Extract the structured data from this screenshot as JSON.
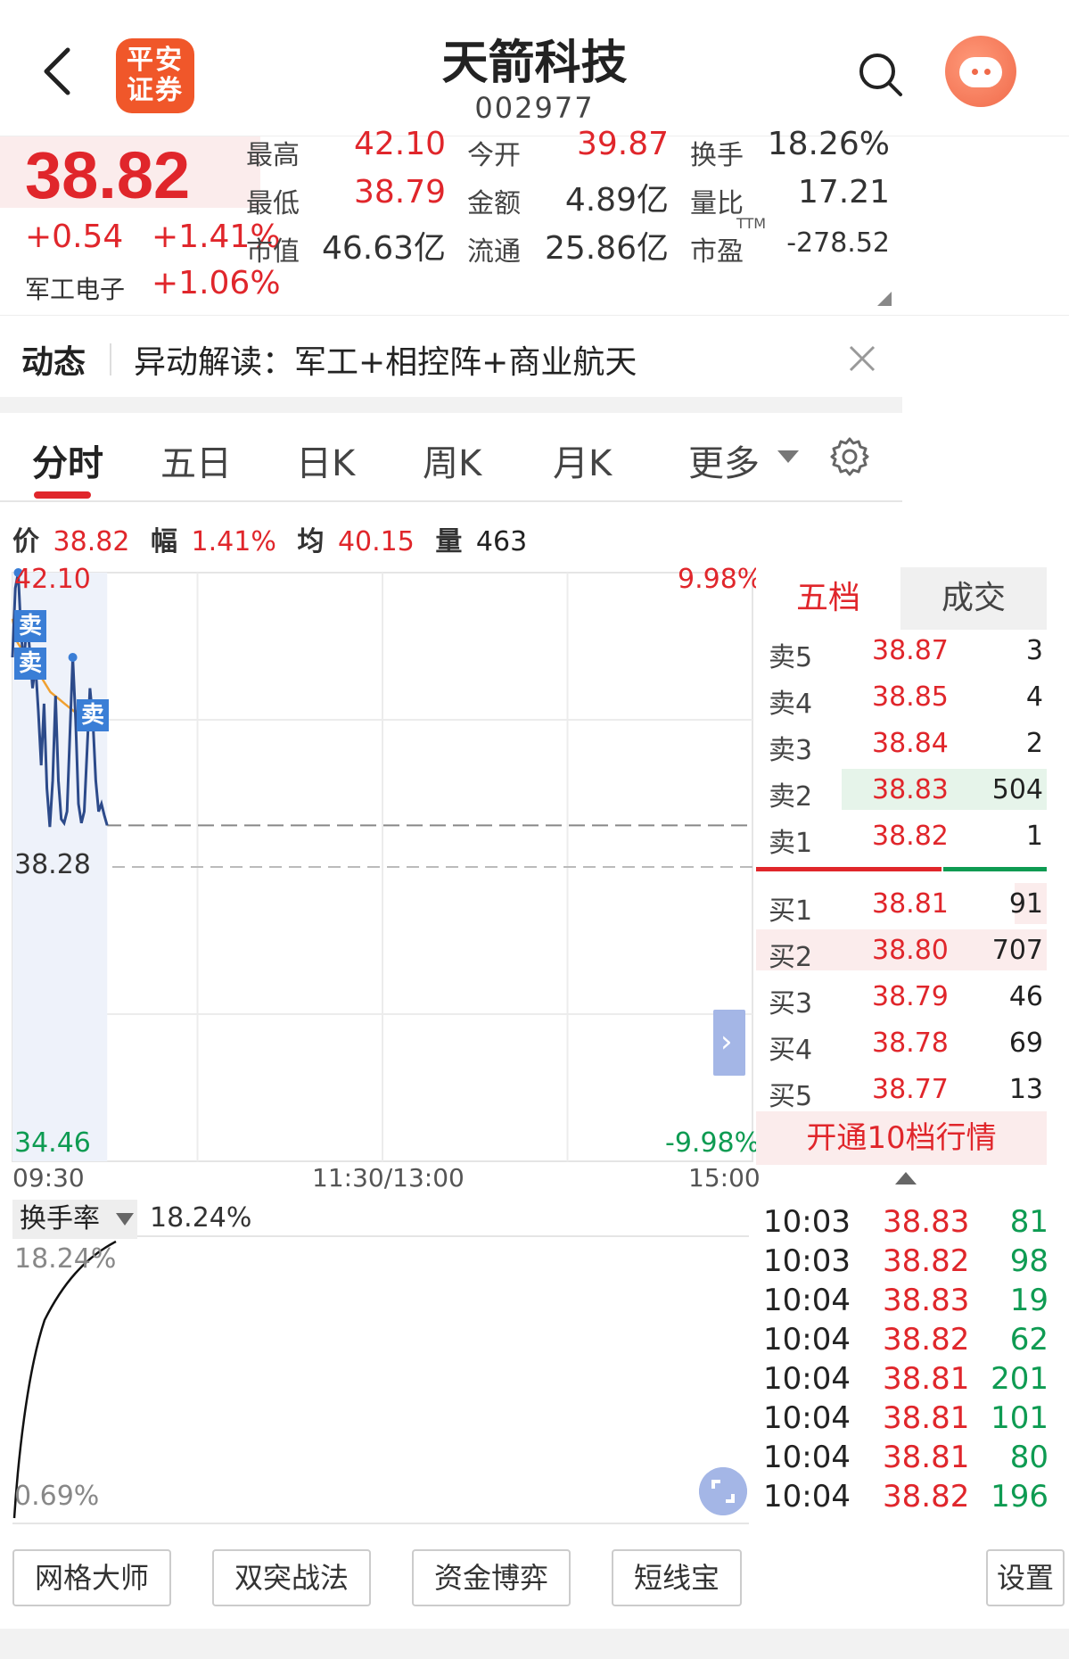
{
  "header": {
    "logo_line1": "平安",
    "logo_line2": "证券",
    "stock_name": "天箭科技",
    "stock_code": "002977"
  },
  "quote": {
    "price": "38.82",
    "change": "+0.54",
    "change_pct": "+1.41%",
    "sector_name": "军工电子",
    "sector_pct": "+1.06%",
    "fields": [
      {
        "label": "最高",
        "value": "42.10",
        "color": "red"
      },
      {
        "label": "今开",
        "value": "39.87",
        "color": "red"
      },
      {
        "label": "换手",
        "value": "18.26%",
        "color": "black"
      },
      {
        "label": "最低",
        "value": "38.79",
        "color": "red"
      },
      {
        "label": "金额",
        "value": "4.89亿",
        "color": "black"
      },
      {
        "label": "量比",
        "value": "17.21",
        "color": "black"
      },
      {
        "label": "市值",
        "value": "46.63亿",
        "color": "black"
      },
      {
        "label": "流通",
        "value": "25.86亿",
        "color": "black"
      },
      {
        "label": "市盈",
        "value": "-278.52",
        "color": "black"
      }
    ],
    "pe_superscript": "TTM"
  },
  "news": {
    "tag": "动态",
    "text": "异动解读：军工+相控阵+商业航天"
  },
  "tabs": [
    "分时",
    "五日",
    "日K",
    "周K",
    "月K",
    "更多"
  ],
  "info_row": {
    "price_label": "价",
    "price_value": "38.82",
    "range_label": "幅",
    "range_value": "1.41%",
    "avg_label": "均",
    "avg_value": "40.15",
    "vol_label": "量",
    "vol_value": "463"
  },
  "chart": {
    "y_max_label": "42.10",
    "y_mid_label": "38.28",
    "y_min_label": "34.46",
    "pct_max_label": "9.98%",
    "pct_min_label": "-9.98%",
    "sell_tag": "卖",
    "time_labels": [
      "09:30",
      "11:30/13:00",
      "15:00"
    ],
    "expand_glyph": "›"
  },
  "chart_data": {
    "type": "line",
    "title": "",
    "xlabel": "",
    "ylabel": "",
    "ylim": [
      34.46,
      42.1
    ],
    "prev_close": 38.28,
    "x_range": [
      "09:30",
      "15:00"
    ],
    "series": [
      {
        "values": [
          41.0,
          41.9,
          42.1,
          41.3,
          40.9,
          41.5,
          41.1,
          40.6,
          40.9,
          40.3,
          39.6,
          40.4,
          39.3,
          38.8,
          39.4,
          40.5,
          39.4,
          38.9,
          38.85,
          39.0,
          40.0,
          41.0,
          40.2,
          39.1,
          38.85,
          39.0,
          39.8,
          40.6,
          40.2,
          39.4,
          39.0,
          39.1,
          38.95,
          38.82
        ]
      },
      {
        "values": [
          41.5,
          41.2,
          41.1,
          41.0,
          40.95,
          40.85,
          40.75,
          40.65,
          40.55,
          40.5,
          40.45,
          40.4,
          40.35,
          40.3,
          40.3,
          40.28,
          40.25,
          40.22,
          40.2,
          40.18,
          40.15
        ]
      }
    ]
  },
  "order_book": {
    "tab_active": "五档",
    "tab_other": "成交",
    "asks": [
      {
        "label": "卖5",
        "price": "38.87",
        "qty": "3"
      },
      {
        "label": "卖4",
        "price": "38.85",
        "qty": "4"
      },
      {
        "label": "卖3",
        "price": "38.84",
        "qty": "2"
      },
      {
        "label": "卖2",
        "price": "38.83",
        "qty": "504"
      },
      {
        "label": "卖1",
        "price": "38.82",
        "qty": "1"
      }
    ],
    "bids": [
      {
        "label": "买1",
        "price": "38.81",
        "qty": "91"
      },
      {
        "label": "买2",
        "price": "38.80",
        "qty": "707"
      },
      {
        "label": "买3",
        "price": "38.79",
        "qty": "46"
      },
      {
        "label": "买4",
        "price": "38.78",
        "qty": "69"
      },
      {
        "label": "买5",
        "price": "38.77",
        "qty": "13"
      }
    ],
    "open10": "开通10档行情"
  },
  "turnover": {
    "selector": "换手率",
    "value": "18.24%",
    "top_label": "18.24%",
    "bottom_label": "0.69%"
  },
  "ticks": [
    {
      "time": "10:03",
      "price": "38.83",
      "qty": "81"
    },
    {
      "time": "10:03",
      "price": "38.82",
      "qty": "98"
    },
    {
      "time": "10:04",
      "price": "38.83",
      "qty": "19"
    },
    {
      "time": "10:04",
      "price": "38.82",
      "qty": "62"
    },
    {
      "time": "10:04",
      "price": "38.81",
      "qty": "201"
    },
    {
      "time": "10:04",
      "price": "38.81",
      "qty": "101"
    },
    {
      "time": "10:04",
      "price": "38.81",
      "qty": "80"
    },
    {
      "time": "10:04",
      "price": "38.82",
      "qty": "196"
    }
  ],
  "bottom_buttons": [
    "网格大师",
    "双突战法",
    "资金博弈",
    "短线宝",
    "设置"
  ],
  "colors": {
    "up": "#e0262b",
    "down": "#0e9b52",
    "price_line": "#2c4a8a",
    "avg_line": "#f0a030",
    "accent": "#3a7ed6"
  }
}
